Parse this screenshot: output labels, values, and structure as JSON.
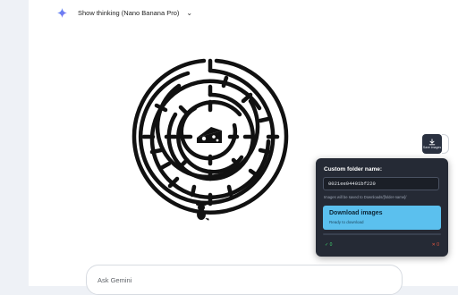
{
  "header": {
    "thinking_label": "Show thinking (Nano Banana Pro)",
    "icons": {
      "sparkle": "gemini-sparkle-icon",
      "chevron": "chevron-down-icon"
    }
  },
  "image": {
    "content": "circular-maze-with-cheese-and-mouse"
  },
  "save_button": {
    "label": "Save images",
    "icon": "download-icon"
  },
  "panel": {
    "title": "Custom folder name:",
    "folder_value": "0021ee04401bf220",
    "hint": "Images will be saved to Downloads/[folder-name]/",
    "download_title": "Download images",
    "download_status": "Ready to download",
    "success_count": "✓ 0",
    "error_count": "✕ 0",
    "progress": 0
  },
  "composer": {
    "placeholder": "Ask Gemini"
  },
  "colors": {
    "accent_blue": "#5bc0ee",
    "panel_bg": "#252a35",
    "success": "#3fce6d",
    "error": "#e0553f"
  }
}
